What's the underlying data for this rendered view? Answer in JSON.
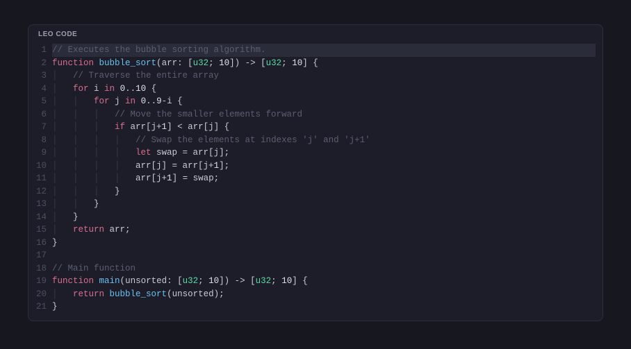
{
  "panel": {
    "title": "LEO CODE"
  },
  "code": {
    "lines": [
      {
        "n": 1,
        "hl": true,
        "tokens": [
          [
            "comment",
            "// Executes the bubble sorting algorithm."
          ]
        ]
      },
      {
        "n": 2,
        "tokens": [
          [
            "keyword",
            "function"
          ],
          [
            "plain",
            " "
          ],
          [
            "func",
            "bubble_sort"
          ],
          [
            "punct",
            "("
          ],
          [
            "param",
            "arr"
          ],
          [
            "punct",
            ": ["
          ],
          [
            "type",
            "u32"
          ],
          [
            "punct",
            "; "
          ],
          [
            "number",
            "10"
          ],
          [
            "punct",
            "]) -> ["
          ],
          [
            "type",
            "u32"
          ],
          [
            "punct",
            "; "
          ],
          [
            "number",
            "10"
          ],
          [
            "punct",
            "] {"
          ]
        ]
      },
      {
        "n": 3,
        "tokens": [
          [
            "guide",
            "│   "
          ],
          [
            "comment",
            "// Traverse the entire array"
          ]
        ]
      },
      {
        "n": 4,
        "tokens": [
          [
            "guide",
            "│   "
          ],
          [
            "keyword",
            "for"
          ],
          [
            "plain",
            " i "
          ],
          [
            "keyword",
            "in"
          ],
          [
            "plain",
            " "
          ],
          [
            "number",
            "0"
          ],
          [
            "punct",
            ".."
          ],
          [
            "number",
            "10"
          ],
          [
            "punct",
            " {"
          ]
        ]
      },
      {
        "n": 5,
        "tokens": [
          [
            "guide",
            "│   │   "
          ],
          [
            "keyword",
            "for"
          ],
          [
            "plain",
            " j "
          ],
          [
            "keyword",
            "in"
          ],
          [
            "plain",
            " "
          ],
          [
            "number",
            "0"
          ],
          [
            "punct",
            ".."
          ],
          [
            "number",
            "9"
          ],
          [
            "punct",
            "-i {"
          ]
        ]
      },
      {
        "n": 6,
        "tokens": [
          [
            "guide",
            "│   │   │   "
          ],
          [
            "comment",
            "// Move the smaller elements forward"
          ]
        ]
      },
      {
        "n": 7,
        "tokens": [
          [
            "guide",
            "│   │   │   "
          ],
          [
            "keyword",
            "if"
          ],
          [
            "plain",
            " arr[j+"
          ],
          [
            "number",
            "1"
          ],
          [
            "plain",
            "] < arr[j] {"
          ]
        ]
      },
      {
        "n": 8,
        "tokens": [
          [
            "guide",
            "│   │   │   │   "
          ],
          [
            "comment",
            "// Swap the elements at indexes 'j' and 'j+1'"
          ]
        ]
      },
      {
        "n": 9,
        "tokens": [
          [
            "guide",
            "│   │   │   │   "
          ],
          [
            "keyword",
            "let"
          ],
          [
            "plain",
            " swap = arr[j];"
          ]
        ]
      },
      {
        "n": 10,
        "tokens": [
          [
            "guide",
            "│   │   │   │   "
          ],
          [
            "plain",
            "arr[j] = arr[j+"
          ],
          [
            "number",
            "1"
          ],
          [
            "plain",
            "];"
          ]
        ]
      },
      {
        "n": 11,
        "tokens": [
          [
            "guide",
            "│   │   │   │   "
          ],
          [
            "plain",
            "arr[j+"
          ],
          [
            "number",
            "1"
          ],
          [
            "plain",
            "] = swap;"
          ]
        ]
      },
      {
        "n": 12,
        "tokens": [
          [
            "guide",
            "│   │   │   "
          ],
          [
            "punct",
            "}"
          ]
        ]
      },
      {
        "n": 13,
        "tokens": [
          [
            "guide",
            "│   │   "
          ],
          [
            "punct",
            "}"
          ]
        ]
      },
      {
        "n": 14,
        "tokens": [
          [
            "guide",
            "│   "
          ],
          [
            "punct",
            "}"
          ]
        ]
      },
      {
        "n": 15,
        "tokens": [
          [
            "guide",
            "│   "
          ],
          [
            "keyword",
            "return"
          ],
          [
            "plain",
            " arr;"
          ]
        ]
      },
      {
        "n": 16,
        "tokens": [
          [
            "punct",
            "}"
          ]
        ]
      },
      {
        "n": 17,
        "tokens": [
          [
            "plain",
            ""
          ]
        ]
      },
      {
        "n": 18,
        "tokens": [
          [
            "comment",
            "// Main function"
          ]
        ]
      },
      {
        "n": 19,
        "tokens": [
          [
            "keyword",
            "function"
          ],
          [
            "plain",
            " "
          ],
          [
            "func",
            "main"
          ],
          [
            "punct",
            "("
          ],
          [
            "param",
            "unsorted"
          ],
          [
            "punct",
            ": ["
          ],
          [
            "type",
            "u32"
          ],
          [
            "punct",
            "; "
          ],
          [
            "number",
            "10"
          ],
          [
            "punct",
            "]) -> ["
          ],
          [
            "type",
            "u32"
          ],
          [
            "punct",
            "; "
          ],
          [
            "number",
            "10"
          ],
          [
            "punct",
            "] {"
          ]
        ]
      },
      {
        "n": 20,
        "tokens": [
          [
            "guide",
            "│   "
          ],
          [
            "keyword",
            "return"
          ],
          [
            "plain",
            " "
          ],
          [
            "func",
            "bubble_sort"
          ],
          [
            "punct",
            "("
          ],
          [
            "plain",
            "unsorted"
          ],
          [
            "punct",
            ");"
          ]
        ]
      },
      {
        "n": 21,
        "tokens": [
          [
            "punct",
            "}"
          ]
        ]
      }
    ]
  }
}
